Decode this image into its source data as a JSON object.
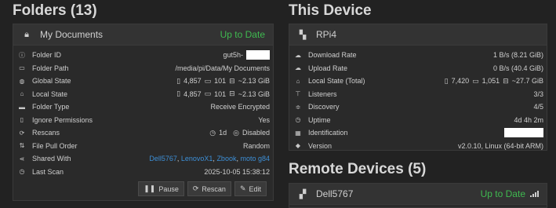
{
  "folders": {
    "title": "Folders (13)",
    "folder": {
      "name": "My Documents",
      "status": "Up to Date",
      "rows": {
        "folder_id": {
          "label": "Folder ID",
          "value": "gut5h-"
        },
        "folder_path": {
          "label": "Folder Path",
          "value": "/media/pi/Data/My Documents"
        },
        "global_state": {
          "label": "Global State",
          "files": "4,857",
          "dirs": "101",
          "size": "~2.13 GiB"
        },
        "local_state": {
          "label": "Local State",
          "files": "4,857",
          "dirs": "101",
          "size": "~2.13 GiB"
        },
        "folder_type": {
          "label": "Folder Type",
          "value": "Receive Encrypted"
        },
        "ignore_permissions": {
          "label": "Ignore Permissions",
          "value": "Yes"
        },
        "rescans": {
          "label": "Rescans",
          "interval": "1d",
          "watcher": "Disabled"
        },
        "file_pull_order": {
          "label": "File Pull Order",
          "value": "Random"
        },
        "shared_with": {
          "label": "Shared With",
          "devices": [
            "Dell5767",
            "LenovoX1",
            "Zbook",
            "moto g84"
          ]
        },
        "last_scan": {
          "label": "Last Scan",
          "value": "2025-10-05 15:38:12"
        }
      },
      "buttons": {
        "pause": "Pause",
        "rescan": "Rescan",
        "edit": "Edit"
      }
    }
  },
  "this_device": {
    "title": "This Device",
    "name": "RPi4",
    "rows": {
      "download_rate": {
        "label": "Download Rate",
        "value": "1 B/s (8.21 GiB)"
      },
      "upload_rate": {
        "label": "Upload Rate",
        "value": "0 B/s (40.4 GiB)"
      },
      "local_state_total": {
        "label": "Local State (Total)",
        "files": "7,420",
        "dirs": "1,051",
        "size": "~27.7 GiB"
      },
      "listeners": {
        "label": "Listeners",
        "value": "3/3"
      },
      "discovery": {
        "label": "Discovery",
        "value": "4/5"
      },
      "uptime": {
        "label": "Uptime",
        "value": "4d 4h 2m"
      },
      "identification": {
        "label": "Identification"
      },
      "version": {
        "label": "Version",
        "value": "v2.0.10, Linux (64-bit ARM)"
      }
    }
  },
  "remote_devices": {
    "title": "Remote Devices (5)",
    "first": {
      "name": "Dell5767",
      "status": "Up to Date"
    }
  },
  "colors": {
    "status_ok": "#3fb950",
    "link": "#3d8fd6",
    "background": "#222222"
  }
}
